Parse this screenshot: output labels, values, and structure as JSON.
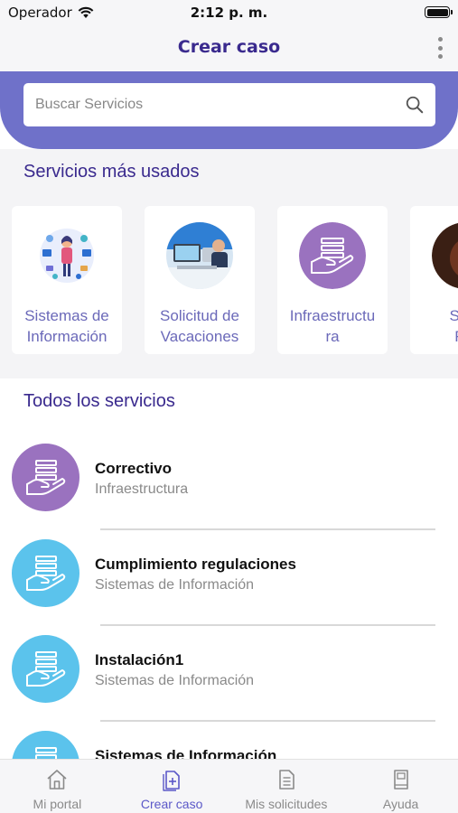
{
  "status_bar": {
    "carrier": "Operador",
    "time": "2:12 p. m."
  },
  "header": {
    "title": "Crear caso",
    "menu_icon": "more-vertical-icon"
  },
  "search": {
    "placeholder": "Buscar Servicios",
    "value": ""
  },
  "popular": {
    "title": "Servicios más usados",
    "items": [
      {
        "label": "Sistemas de\nInformación",
        "icon": "people-tech-illustration-icon"
      },
      {
        "label": "Solicitud de\nVacaciones",
        "icon": "office-desk-photo-icon"
      },
      {
        "label": "Infraestructu\nra",
        "icon": "hand-server-icon"
      },
      {
        "label": "Serv\nFís",
        "icon": "dark-photo-icon"
      }
    ]
  },
  "all_services": {
    "title": "Todos los servicios",
    "items": [
      {
        "name": "Correctivo",
        "category": "Infraestructura",
        "color": "#9a72bf",
        "icon": "hand-server-icon"
      },
      {
        "name": "Cumplimiento regulaciones",
        "category": "Sistemas de Información",
        "color": "#5bc3ec",
        "icon": "hand-server-icon"
      },
      {
        "name": "Instalación1",
        "category": "Sistemas de Información",
        "color": "#5bc3ec",
        "icon": "hand-server-icon"
      },
      {
        "name": "Sistemas de Información",
        "category": "",
        "color": "#5bc3ec",
        "icon": "hand-server-icon"
      }
    ]
  },
  "tabs": [
    {
      "label": "Mi portal",
      "icon": "home-icon",
      "active": false
    },
    {
      "label": "Crear caso",
      "icon": "document-add-icon",
      "active": true
    },
    {
      "label": "Mis solicitudes",
      "icon": "document-list-icon",
      "active": false
    },
    {
      "label": "Ayuda",
      "icon": "book-icon",
      "active": false
    }
  ],
  "colors": {
    "accent": "#3a2a8e",
    "search_band": "#6f71c9",
    "card_label": "#6b69b9",
    "tab_active": "#5b58c8",
    "purple_avatar": "#9a72bf",
    "blue_avatar": "#5bc3ec"
  }
}
